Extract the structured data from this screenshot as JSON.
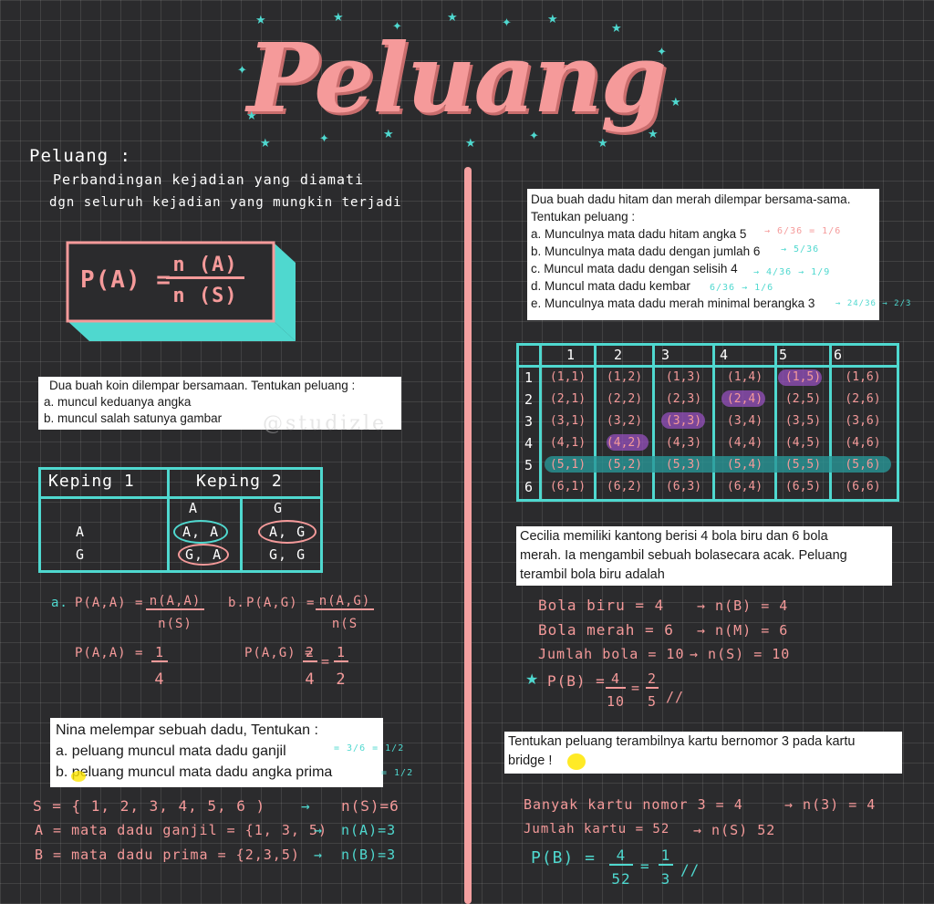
{
  "title": "Peluang",
  "definition": {
    "heading": "Peluang :",
    "line1": "Perbandingan kejadian yang diamati",
    "line2": "dgn seluruh kejadian yang mungkin terjadi"
  },
  "formula": {
    "lhs": "P(A) =",
    "numerator": "n (A)",
    "denominator": "n (S)"
  },
  "coin_problem": {
    "line1": "Dua buah koin dilempar bersamaan. Tentukan peluang :",
    "line2": "a. muncul keduanya angka",
    "line3": "b. muncul salah satunya gambar"
  },
  "watermark": "@studizle",
  "coin_table": {
    "header1": "Keping 1",
    "header2": "Keping 2",
    "col_a": "A",
    "col_g": "G",
    "row_a": "A",
    "row_g": "G",
    "aa": "A, A",
    "ag": "A, G",
    "ga": "G, A",
    "gg": "G, G"
  },
  "coin_solution": {
    "a_label": "a.",
    "a_formula": "P(A,A) =",
    "a_num": "n(A,A)",
    "a_den": "n(S)",
    "b_label": "b.",
    "b_formula": "P(A,G) =",
    "b_num": "n(A,G)",
    "b_den": "n(S",
    "a_result": "P(A,A) =",
    "a_res_num": "1",
    "a_res_den": "4",
    "b_result": "P(A,G) =",
    "b_res_num": "2",
    "b_res_den": "4",
    "b_res_num2": "1",
    "b_res_den2": "2"
  },
  "die_problem": {
    "line1": "Nina melempar sebuah dadu, Tentukan :",
    "line2": "a. peluang muncul mata dadu ganjil",
    "line3": "b. peluang muncul mata dadu angka prima",
    "ans_a": "= 3/6 = 1/2",
    "ans_b": "= 1/2"
  },
  "die_solution": {
    "s_set": "S = { 1, 2, 3, 4, 5, 6 )",
    "s_n": "n(S)=6",
    "a_set": "A = mata dadu ganjil = {1, 3, 5)",
    "a_n": "n(A)=3",
    "b_set": "B = mata dadu prima = {2,3,5)",
    "b_n": "n(B)=3"
  },
  "dice_problem": {
    "line1": "Dua buah dadu hitam dan merah dilempar bersama-sama.",
    "line2": "Tentukan peluang :",
    "line3": "a. Munculnya mata dadu hitam angka 5",
    "line4": "b. Munculnya mata dadu dengan  jumlah 6",
    "line5": "c. Muncul mata dadu dengan selisih 4",
    "line6": "d. Muncul mata dadu kembar",
    "line7": "e. Munculnya mata dadu merah minimal berangka 3",
    "ans_a": "→ 6/36 = 1/6",
    "ans_b": "→ 5/36",
    "ans_c": "→ 4/36 → 1/9",
    "ans_d": "6/36 → 1/6",
    "ans_e": "→ 24/36 → 2/3"
  },
  "dice_table": {
    "cols": [
      "1",
      "2",
      "3",
      "4",
      "5",
      "6"
    ],
    "rows": [
      [
        "(1,1)",
        "(1,2)",
        "(1,3)",
        "(1,4)",
        "(1,5)",
        "(1,6)"
      ],
      [
        "(2,1)",
        "(2,2)",
        "(2,3)",
        "(2,4)",
        "(2,5)",
        "(2,6)"
      ],
      [
        "(3,1)",
        "(3,2)",
        "(3,3)",
        "(3,4)",
        "(3,5)",
        "(3,6)"
      ],
      [
        "(4,1)",
        "(4,2)",
        "(4,3)",
        "(4,4)",
        "(4,5)",
        "(4,6)"
      ],
      [
        "(5,1)",
        "(5,2)",
        "(5,3)",
        "(5,4)",
        "(5,5)",
        "(5,6)"
      ],
      [
        "(6,1)",
        "(6,2)",
        "(6,3)",
        "(6,4)",
        "(6,5)",
        "(6,6)"
      ]
    ],
    "row_labels": [
      "1",
      "2",
      "3",
      "4",
      "5",
      "6"
    ]
  },
  "ball_problem": {
    "line1": "Cecilia memiliki kantong berisi 4 bola biru dan 6 bola",
    "line2": "merah. Ia mengambil sebuah bolasecara acak. Peluang",
    "line3": "terambil bola biru adalah"
  },
  "ball_solution": {
    "l1": "Bola biru = 4",
    "r1": "→ n(B) = 4",
    "l2": "Bola merah = 6",
    "r2": "→ n(M) = 6",
    "l3": "Jumlah bola = 10",
    "r3": "→ n(S) = 10",
    "p_label": "P(B) =",
    "p_num": "4",
    "p_den": "10",
    "p_num2": "2",
    "p_den2": "5"
  },
  "card_problem": {
    "line1": "Tentukan peluang terambilnya kartu bernomor 3 pada kartu",
    "line2": "bridge !"
  },
  "card_solution": {
    "l1": "Banyak kartu nomor 3 = 4",
    "r1": "→ n(3) = 4",
    "l2": "Jumlah kartu = 52",
    "r2": "→ n(S) 52",
    "p_label": "P(B) =",
    "p_num": "4",
    "p_den": "52",
    "p_num2": "1",
    "p_den2": "3"
  },
  "colors": {
    "pink": "#f59a9a",
    "teal": "#4fd8cf",
    "background": "#2b2b2d"
  }
}
